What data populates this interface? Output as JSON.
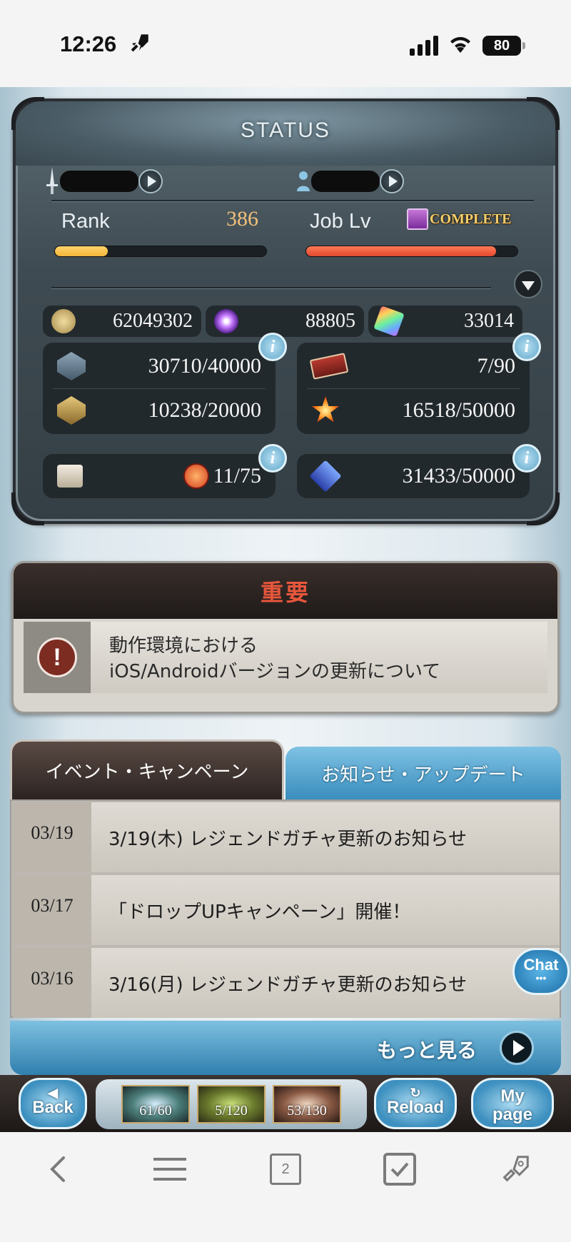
{
  "ios_status": {
    "time": "12:26",
    "battery": "80"
  },
  "status_panel": {
    "title": "STATUS",
    "rank_label": "Rank",
    "rank_value": "386",
    "rank_progress": 0.25,
    "job_label": "Job Lv",
    "job_value": "COMPLETE",
    "job_progress": 0.9,
    "currencies": [
      {
        "icon": "rupie-coin-icon",
        "value": "62049302"
      },
      {
        "icon": "crystal-orb-icon",
        "value": "88805"
      },
      {
        "icon": "rainbow-crystal-icon",
        "value": "33014"
      }
    ],
    "stats_left": [
      {
        "icon": "silver-gem-icon",
        "value": "30710/40000"
      },
      {
        "icon": "gold-gem-icon",
        "value": "10238/20000"
      }
    ],
    "stats_right": [
      {
        "icon": "ticket-icon",
        "value": "7/90"
      },
      {
        "icon": "burst-star-icon",
        "value": "16518/50000"
      }
    ],
    "stats_bottom_left": {
      "icon": "chest-icon",
      "badge": "rank-up-badge-icon",
      "value": "11/75"
    },
    "stats_bottom_right": {
      "icon": "heart-gem-icon",
      "value": "31433/50000"
    }
  },
  "notice": {
    "title": "重要",
    "lines": [
      "動作環境における",
      "iOS/Androidバージョンの更新について"
    ]
  },
  "tabs": {
    "active": "イベント・キャンペーン",
    "inactive": "お知らせ・アップデート"
  },
  "news": [
    {
      "date": "03/19",
      "text": "3/19(木) レジェンドガチャ更新のお知らせ"
    },
    {
      "date": "03/17",
      "text": "「ドロップUPキャンペーン」開催！"
    },
    {
      "date": "03/16",
      "text": "3/16(月) レジェンドガチャ更新のお知らせ"
    }
  ],
  "chat_label": "Chat",
  "more_label": "もっと見る",
  "game_nav": {
    "back": "Back",
    "reload": "Reload",
    "mypage_line1": "My",
    "mypage_line2": "page",
    "ap": [
      "61/60",
      "5/120",
      "53/130"
    ]
  },
  "safari": {
    "tabs_count": "2"
  },
  "colors": {
    "rank_bar": "#f2b63a",
    "job_bar": "#e2482f",
    "notice_title": "#e8573c",
    "tab_blue": "#3a8dbd"
  }
}
